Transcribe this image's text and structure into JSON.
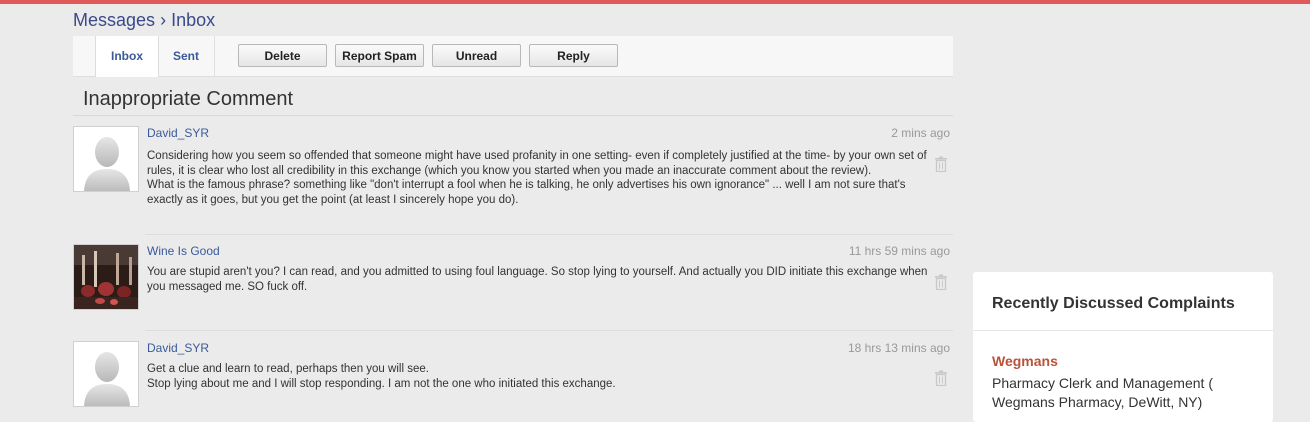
{
  "breadcrumb": {
    "messages": "Messages",
    "separator": "›",
    "inbox": "Inbox"
  },
  "tabs": {
    "inbox": "Inbox",
    "sent": "Sent"
  },
  "toolbar": {
    "delete_label": "Delete",
    "spam_label": "Report Spam",
    "unread_label": "Unread",
    "reply_label": "Reply"
  },
  "subject": "Inappropriate Comment",
  "messages": [
    {
      "author": "David_SYR",
      "time": "2 mins ago",
      "avatar": "default-avatar-silhouette",
      "lines": [
        "Considering how you seem so offended that someone might have used profanity in one setting- even if completely justified at the time- by your own set of rules, it is clear who lost all credibility in this exchange (which you know you started when you made an inaccurate comment about the review).",
        "What is the famous phrase? something like \"don't interrupt a fool when he is talking, he only advertises his own ignorance\" ... well I am not sure that's exactly as it goes, but you get the point (at least I sincerely hope you do)."
      ]
    },
    {
      "author": "Wine Is Good",
      "time": "11 hrs 59 mins ago",
      "avatar": "wine-photo",
      "lines": [
        "You are stupid aren't you? I can read, and you admitted to using foul language. So stop lying to yourself. And actually you DID initiate this exchange when you messaged me. SO fuck off."
      ]
    },
    {
      "author": "David_SYR",
      "time": "18 hrs 13 mins ago",
      "avatar": "default-avatar-silhouette",
      "lines": [
        "Get a clue and learn to read, perhaps then you will see.",
        "Stop lying about me and I will stop responding. I am not the one who initiated this exchange."
      ]
    }
  ],
  "sidebar": {
    "title": "Recently Discussed Complaints",
    "company": "Wegmans",
    "description": "Pharmacy Clerk and Management ( Wegmans Pharmacy, DeWitt, NY)"
  },
  "colors": {
    "accent_bar": "#e05a5a",
    "link": "#3a5a9a",
    "company": "#b9533a"
  }
}
